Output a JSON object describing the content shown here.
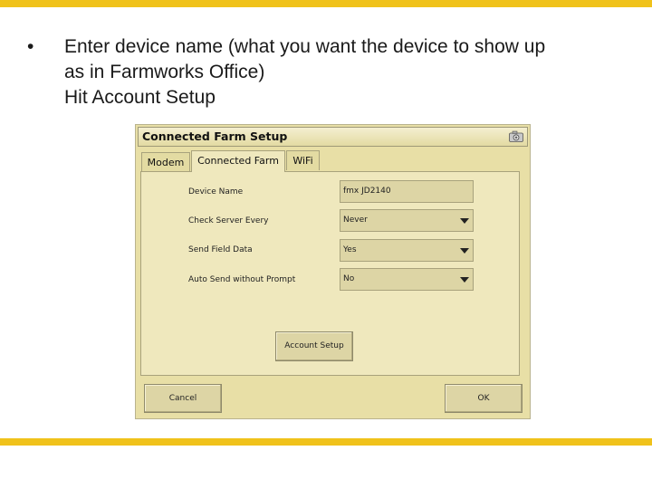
{
  "slide": {
    "bullet_char": "•",
    "lines": [
      "Enter device name (what you want the device to show up",
      "as in Farmworks Office)",
      "Hit Account Setup"
    ]
  },
  "dialog": {
    "title": "Connected Farm Setup",
    "tabs": [
      {
        "label": "Modem",
        "active": false
      },
      {
        "label": "Connected Farm",
        "active": true
      },
      {
        "label": "WiFi",
        "active": false
      }
    ],
    "fields": {
      "device_name": {
        "label": "Device Name",
        "value": "fmx JD2140"
      },
      "check_server": {
        "label": "Check Server Every",
        "value": "Never"
      },
      "send_field_data": {
        "label": "Send Field Data",
        "value": "Yes"
      },
      "auto_send": {
        "label": "Auto Send without Prompt",
        "value": "No"
      }
    },
    "account_setup_label": "Account Setup",
    "cancel_label": "Cancel",
    "ok_label": "OK"
  },
  "colors": {
    "accent_bar": "#f0c21b",
    "dialog_bg": "#e8dfa6",
    "panel_bg": "#efe8bd"
  },
  "icons": {
    "titlebar": "camera-icon"
  }
}
